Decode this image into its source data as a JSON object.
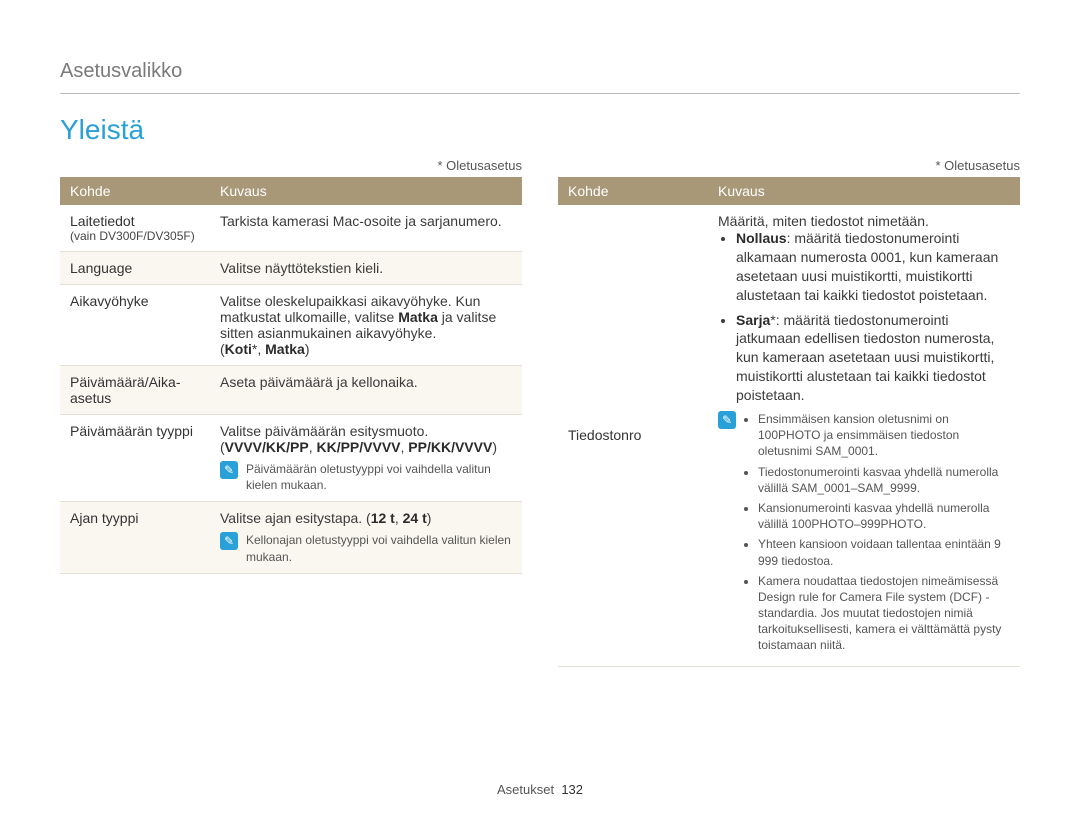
{
  "breadcrumb": "Asetusvalikko",
  "title": "Yleistä",
  "default_note": "* Oletusasetus",
  "headers": {
    "kohde": "Kohde",
    "kuvaus": "Kuvaus"
  },
  "left": {
    "r1": {
      "k": "Laitetiedot",
      "ksub": "(vain DV300F/DV305F)",
      "v": "Tarkista kamerasi Mac-osoite ja sarjanumero."
    },
    "r2": {
      "k": "Language",
      "v": "Valitse näyttötekstien kieli."
    },
    "r3": {
      "k": "Aikavyöhyke",
      "v1": "Valitse oleskelupaikkasi aikavyöhyke. Kun matkustat ulkomaille, valitse ",
      "vbold": "Matka",
      "v2": " ja valitse sitten asianmukainen aikavyöhyke.",
      "opts_prefix": "(",
      "opts_bold1": "Koti",
      "opts_star": "*",
      "opts_sep": ", ",
      "opts_bold2": "Matka",
      "opts_suffix": ")"
    },
    "r4": {
      "k": "Päivämäärä/Aika-asetus",
      "v": "Aseta päivämäärä ja kellonaika."
    },
    "r5": {
      "k": "Päivämäärän tyyppi",
      "v": "Valitse päivämäärän esitysmuoto.",
      "opts_prefix": "(",
      "opts_bold": "VVVV/KK/PP",
      "opts_sep1": ", ",
      "opts_b2": "KK/PP/VVVV",
      "opts_sep2": ", ",
      "opts_b3": "PP/KK/VVVV",
      "opts_suffix": ")",
      "note": "Päivämäärän oletustyyppi voi vaihdella valitun kielen mukaan."
    },
    "r6": {
      "k": "Ajan tyyppi",
      "v1": "Valitse ajan esitystapa. (",
      "b1": "12 t",
      "sep": ", ",
      "b2": "24 t",
      "v2": ")",
      "note": "Kellonajan oletustyyppi voi vaihdella valitun kielen mukaan."
    }
  },
  "right": {
    "r1": {
      "k": "Tiedostonro",
      "intro": "Määritä, miten tiedostot nimetään.",
      "b1label": "Nollaus",
      "b1text": ": määritä tiedostonumerointi alkamaan numerosta 0001, kun kameraan asetetaan uusi muistikortti, muistikortti alustetaan tai kaikki tiedostot poistetaan.",
      "b2label": "Sarja",
      "b2star": "*",
      "b2text": ": määritä tiedostonumerointi jatkumaan edellisen tiedoston numerosta, kun kameraan asetetaan uusi muistikortti, muistikortti alustetaan tai kaikki tiedostot poistetaan.",
      "n1": "Ensimmäisen kansion oletusnimi on 100PHOTO ja ensimmäisen tiedoston oletusnimi SAM_0001.",
      "n2": "Tiedostonumerointi kasvaa yhdellä numerolla välillä SAM_0001–SAM_9999.",
      "n3": "Kansionumerointi kasvaa yhdellä numerolla välillä 100PHOTO–999PHOTO.",
      "n4": "Yhteen kansioon voidaan tallentaa enintään 9 999 tiedostoa.",
      "n5": "Kamera noudattaa tiedostojen nimeämisessä Design rule for Camera File system (DCF) -standardia. Jos muutat tiedostojen nimiä tarkoituksellisesti, kamera ei välttämättä pysty toistamaan niitä."
    }
  },
  "footer": {
    "section": "Asetukset",
    "page": "132"
  }
}
